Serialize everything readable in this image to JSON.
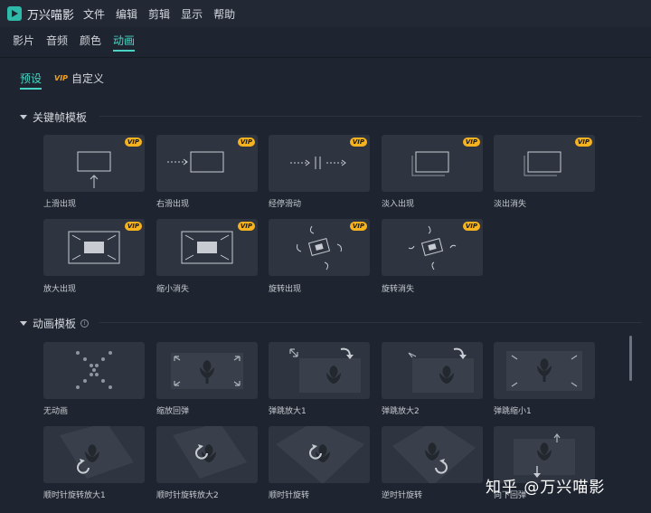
{
  "app": {
    "title": "万兴喵影"
  },
  "menu": [
    "文件",
    "编辑",
    "剪辑",
    "显示",
    "帮助"
  ],
  "tabs": [
    {
      "label": "影片",
      "active": false
    },
    {
      "label": "音频",
      "active": false
    },
    {
      "label": "颜色",
      "active": false
    },
    {
      "label": "动画",
      "active": true
    }
  ],
  "subtabs": {
    "preset": "预设",
    "vip": "VIP",
    "custom": "自定义"
  },
  "sections": {
    "keyframe": {
      "title": "关键帧模板"
    },
    "animation": {
      "title": "动画模板",
      "help": "i"
    }
  },
  "keyframe_cards": [
    {
      "label": "上滑出现",
      "vip": "VIP",
      "icon": "slide-up-icon"
    },
    {
      "label": "右滑出现",
      "vip": "VIP",
      "icon": "slide-right-icon"
    },
    {
      "label": "经停滑动",
      "vip": "VIP",
      "icon": "pause-slide-icon"
    },
    {
      "label": "淡入出现",
      "vip": "VIP",
      "icon": "fade-in-icon"
    },
    {
      "label": "淡出消失",
      "vip": "VIP",
      "icon": "fade-out-icon"
    },
    {
      "label": "放大出现",
      "vip": "VIP",
      "icon": "zoom-in-icon"
    },
    {
      "label": "缩小消失",
      "vip": "VIP",
      "icon": "zoom-out-icon"
    },
    {
      "label": "旋转出现",
      "vip": "VIP",
      "icon": "rotate-in-icon"
    },
    {
      "label": "旋转消失",
      "vip": "VIP",
      "icon": "rotate-out-icon"
    }
  ],
  "animation_cards": [
    {
      "label": "无动画",
      "icon": "no-animation-icon"
    },
    {
      "label": "缩放回弹",
      "icon": "zoom-bounce-icon"
    },
    {
      "label": "弹跳放大1",
      "icon": "bounce-zoom-in-1-icon"
    },
    {
      "label": "弹跳放大2",
      "icon": "bounce-zoom-in-2-icon"
    },
    {
      "label": "弹跳缩小1",
      "icon": "bounce-zoom-out-1-icon"
    },
    {
      "label": "顺时针旋转放大1",
      "icon": "cw-rotate-zoom-1-icon"
    },
    {
      "label": "顺时针旋转放大2",
      "icon": "cw-rotate-zoom-2-icon"
    },
    {
      "label": "顺时针旋转",
      "icon": "cw-rotate-icon"
    },
    {
      "label": "逆时针旋转",
      "icon": "ccw-rotate-icon"
    },
    {
      "label": "向下回弹",
      "icon": "down-bounce-icon"
    }
  ],
  "watermark": "知乎 @万兴喵影",
  "colors": {
    "accent": "#48d4c5",
    "vip": "#f6b31e",
    "card": "#2f3540",
    "background": "#1f2530"
  }
}
